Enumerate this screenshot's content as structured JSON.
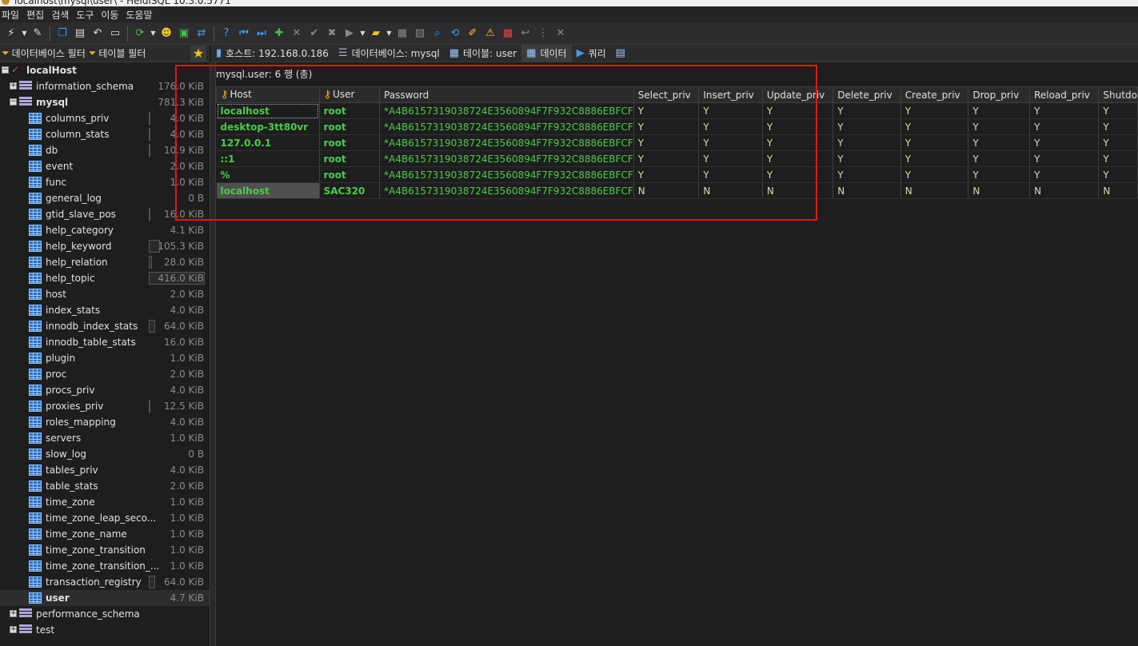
{
  "window": {
    "title": "localhost\\mysql\\user\\ - HeidiSQL 10.3.0.5771"
  },
  "menu": [
    "파일",
    "편집",
    "검색",
    "도구",
    "이동",
    "도움말"
  ],
  "filters": {
    "db_filter": "데이터베이스 필터",
    "table_filter": "테이블 필터"
  },
  "tabs": [
    {
      "label": "호스트: 192.168.0.186",
      "icon": "host-icon"
    },
    {
      "label": "데이터베이스: mysql",
      "icon": "database-icon"
    },
    {
      "label": "테이블: user",
      "icon": "table-icon"
    },
    {
      "label": "데이터",
      "icon": "data-grid-icon"
    },
    {
      "label": "쿼리",
      "icon": "play-icon"
    }
  ],
  "tree": {
    "root": "localHost",
    "databases": [
      {
        "name": "information_schema",
        "size": "176.0 KiB"
      },
      {
        "name": "mysql",
        "size": "781.3 KiB"
      },
      {
        "name": "performance_schema",
        "size": ""
      },
      {
        "name": "test",
        "size": ""
      }
    ],
    "tables": [
      {
        "name": "columns_priv",
        "size": "4.0 KiB"
      },
      {
        "name": "column_stats",
        "size": "4.0 KiB"
      },
      {
        "name": "db",
        "size": "10.9 KiB"
      },
      {
        "name": "event",
        "size": "2.0 KiB"
      },
      {
        "name": "func",
        "size": "1.0 KiB"
      },
      {
        "name": "general_log",
        "size": "0 B"
      },
      {
        "name": "gtid_slave_pos",
        "size": "16.0 KiB"
      },
      {
        "name": "help_category",
        "size": "4.1 KiB"
      },
      {
        "name": "help_keyword",
        "size": "105.3 KiB"
      },
      {
        "name": "help_relation",
        "size": "28.0 KiB"
      },
      {
        "name": "help_topic",
        "size": "416.0 KiB"
      },
      {
        "name": "host",
        "size": "2.0 KiB"
      },
      {
        "name": "index_stats",
        "size": "4.0 KiB"
      },
      {
        "name": "innodb_index_stats",
        "size": "64.0 KiB"
      },
      {
        "name": "innodb_table_stats",
        "size": "16.0 KiB"
      },
      {
        "name": "plugin",
        "size": "1.0 KiB"
      },
      {
        "name": "proc",
        "size": "2.0 KiB"
      },
      {
        "name": "procs_priv",
        "size": "4.0 KiB"
      },
      {
        "name": "proxies_priv",
        "size": "12.5 KiB"
      },
      {
        "name": "roles_mapping",
        "size": "4.0 KiB"
      },
      {
        "name": "servers",
        "size": "1.0 KiB"
      },
      {
        "name": "slow_log",
        "size": "0 B"
      },
      {
        "name": "tables_priv",
        "size": "4.0 KiB"
      },
      {
        "name": "table_stats",
        "size": "2.0 KiB"
      },
      {
        "name": "time_zone",
        "size": "1.0 KiB"
      },
      {
        "name": "time_zone_leap_seco...",
        "size": "1.0 KiB"
      },
      {
        "name": "time_zone_name",
        "size": "1.0 KiB"
      },
      {
        "name": "time_zone_transition",
        "size": "1.0 KiB"
      },
      {
        "name": "time_zone_transition_...",
        "size": "1.0 KiB"
      },
      {
        "name": "transaction_registry",
        "size": "64.0 KiB"
      },
      {
        "name": "user",
        "size": "4.7 KiB"
      }
    ]
  },
  "grid": {
    "title": "mysql.user: 6 행 (총)",
    "columns": [
      "Host",
      "User",
      "Password",
      "Select_priv",
      "Insert_priv",
      "Update_priv",
      "Delete_priv",
      "Create_priv",
      "Drop_priv",
      "Reload_priv",
      "Shutdo"
    ],
    "rows": [
      [
        "localhost",
        "root",
        "*A4B6157319038724E3560894F7F932C8886EBFCF",
        "Y",
        "Y",
        "Y",
        "Y",
        "Y",
        "Y",
        "Y",
        "Y"
      ],
      [
        "desktop-3tt80vr",
        "root",
        "*A4B6157319038724E3560894F7F932C8886EBFCF",
        "Y",
        "Y",
        "Y",
        "Y",
        "Y",
        "Y",
        "Y",
        "Y"
      ],
      [
        "127.0.0.1",
        "root",
        "*A4B6157319038724E3560894F7F932C8886EBFCF",
        "Y",
        "Y",
        "Y",
        "Y",
        "Y",
        "Y",
        "Y",
        "Y"
      ],
      [
        "::1",
        "root",
        "*A4B6157319038724E3560894F7F932C8886EBFCF",
        "Y",
        "Y",
        "Y",
        "Y",
        "Y",
        "Y",
        "Y",
        "Y"
      ],
      [
        "%",
        "root",
        "*A4B6157319038724E3560894F7F932C8886EBFCF",
        "Y",
        "Y",
        "Y",
        "Y",
        "Y",
        "Y",
        "Y",
        "Y"
      ],
      [
        "localhost",
        "SAC320",
        "*A4B6157319038724E3560894F7F932C8886EBFCF",
        "N",
        "N",
        "N",
        "N",
        "N",
        "N",
        "N",
        "N"
      ]
    ]
  },
  "colors": {
    "highlight_box": "#e0161b",
    "cell_text": "#4ec94e",
    "key_icon": "#f0b020"
  }
}
